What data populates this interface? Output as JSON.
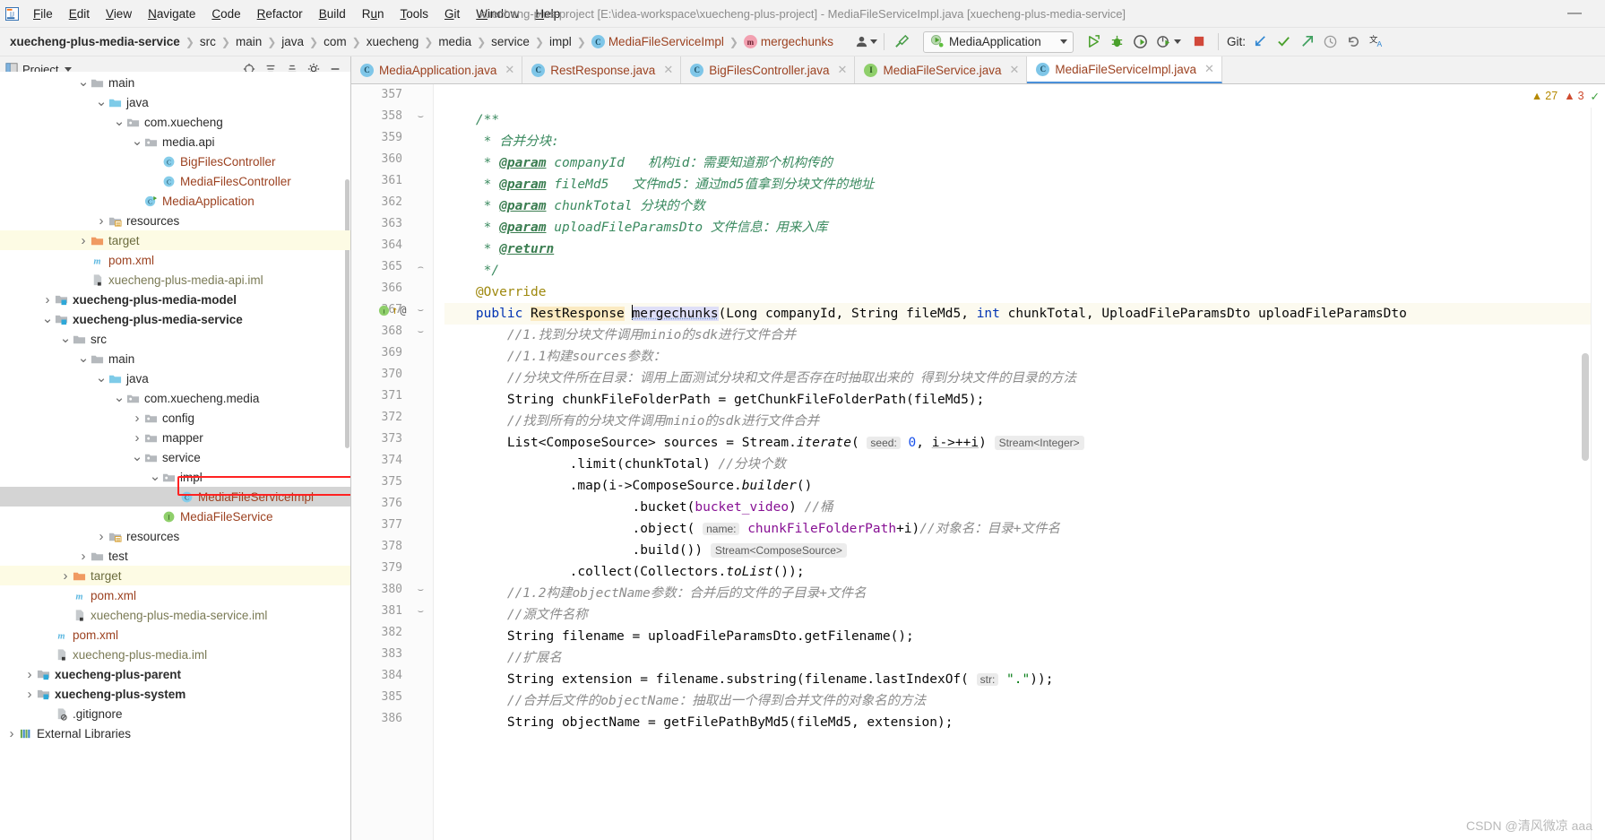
{
  "window": {
    "title": "xuecheng-plus-project [E:\\idea-workspace\\xuecheng-plus-project] - MediaFileServiceImpl.java [xuecheng-plus-media-service]",
    "minimize": "—"
  },
  "menubar": [
    {
      "label": "File"
    },
    {
      "label": "Edit"
    },
    {
      "label": "View"
    },
    {
      "label": "Navigate"
    },
    {
      "label": "Code"
    },
    {
      "label": "Refactor"
    },
    {
      "label": "Build"
    },
    {
      "label": "Run"
    },
    {
      "label": "Tools"
    },
    {
      "label": "Git"
    },
    {
      "label": "Window"
    },
    {
      "label": "Help"
    }
  ],
  "navbar": {
    "crumbs": [
      {
        "label": "xuecheng-plus-media-service",
        "bold": true
      },
      {
        "label": "src"
      },
      {
        "label": "main"
      },
      {
        "label": "java"
      },
      {
        "label": "com"
      },
      {
        "label": "xuecheng"
      },
      {
        "label": "media"
      },
      {
        "label": "service"
      },
      {
        "label": "impl"
      },
      {
        "label": "MediaFileServiceImpl",
        "badge": "c"
      },
      {
        "label": "mergechunks",
        "badge": "m"
      }
    ],
    "run_config": "MediaApplication",
    "git_label": "Git:",
    "separator": "›"
  },
  "project_panel": {
    "title": "Project",
    "tree": [
      {
        "indent": 4,
        "arrow": "v",
        "icon": "folder-gray",
        "label": "main",
        "style": "plain",
        "partial": true
      },
      {
        "indent": 5,
        "arrow": "v",
        "icon": "folder-blue",
        "label": "java",
        "style": "plain"
      },
      {
        "indent": 6,
        "arrow": "v",
        "icon": "package",
        "label": "com.xuecheng",
        "style": "plain"
      },
      {
        "indent": 7,
        "arrow": "v",
        "icon": "package",
        "label": "media.api",
        "style": "plain"
      },
      {
        "indent": 8,
        "arrow": "",
        "icon": "class",
        "label": "BigFilesController",
        "style": "cls"
      },
      {
        "indent": 8,
        "arrow": "",
        "icon": "class",
        "label": "MediaFilesController",
        "style": "cls"
      },
      {
        "indent": 7,
        "arrow": "",
        "icon": "class-run",
        "label": "MediaApplication",
        "style": "cls"
      },
      {
        "indent": 5,
        "arrow": ">",
        "icon": "folder-res",
        "label": "resources",
        "style": "plain"
      },
      {
        "indent": 4,
        "arrow": ">",
        "icon": "folder-orange",
        "label": "target",
        "style": "target",
        "highlight": true
      },
      {
        "indent": 4,
        "arrow": "",
        "icon": "maven",
        "label": "pom.xml",
        "style": "pom"
      },
      {
        "indent": 4,
        "arrow": "",
        "icon": "iml",
        "label": "xuecheng-plus-media-api.iml",
        "style": "file"
      },
      {
        "indent": 2,
        "arrow": ">",
        "icon": "module",
        "label": "xuecheng-plus-media-model",
        "style": "bold"
      },
      {
        "indent": 2,
        "arrow": "v",
        "icon": "module",
        "label": "xuecheng-plus-media-service",
        "style": "bold"
      },
      {
        "indent": 3,
        "arrow": "v",
        "icon": "folder-gray",
        "label": "src",
        "style": "plain"
      },
      {
        "indent": 4,
        "arrow": "v",
        "icon": "folder-gray",
        "label": "main",
        "style": "plain"
      },
      {
        "indent": 5,
        "arrow": "v",
        "icon": "folder-blue",
        "label": "java",
        "style": "plain"
      },
      {
        "indent": 6,
        "arrow": "v",
        "icon": "package",
        "label": "com.xuecheng.media",
        "style": "plain"
      },
      {
        "indent": 7,
        "arrow": ">",
        "icon": "package",
        "label": "config",
        "style": "plain"
      },
      {
        "indent": 7,
        "arrow": ">",
        "icon": "package",
        "label": "mapper",
        "style": "plain"
      },
      {
        "indent": 7,
        "arrow": "v",
        "icon": "package",
        "label": "service",
        "style": "plain"
      },
      {
        "indent": 8,
        "arrow": "v",
        "icon": "package",
        "label": "impl",
        "style": "plain"
      },
      {
        "indent": 9,
        "arrow": "",
        "icon": "class",
        "label": "MediaFileServiceImpl",
        "style": "cls",
        "selected": true,
        "outlined": true
      },
      {
        "indent": 8,
        "arrow": "",
        "icon": "interface",
        "label": "MediaFileService",
        "style": "cls"
      },
      {
        "indent": 5,
        "arrow": ">",
        "icon": "folder-res",
        "label": "resources",
        "style": "plain"
      },
      {
        "indent": 4,
        "arrow": ">",
        "icon": "folder-gray",
        "label": "test",
        "style": "plain"
      },
      {
        "indent": 3,
        "arrow": ">",
        "icon": "folder-orange",
        "label": "target",
        "style": "target",
        "highlight": true
      },
      {
        "indent": 3,
        "arrow": "",
        "icon": "maven",
        "label": "pom.xml",
        "style": "pom"
      },
      {
        "indent": 3,
        "arrow": "",
        "icon": "iml",
        "label": "xuecheng-plus-media-service.iml",
        "style": "file"
      },
      {
        "indent": 2,
        "arrow": "",
        "icon": "maven",
        "label": "pom.xml",
        "style": "pom"
      },
      {
        "indent": 2,
        "arrow": "",
        "icon": "iml",
        "label": "xuecheng-plus-media.iml",
        "style": "file"
      },
      {
        "indent": 1,
        "arrow": ">",
        "icon": "module",
        "label": "xuecheng-plus-parent",
        "style": "bold"
      },
      {
        "indent": 1,
        "arrow": ">",
        "icon": "module",
        "label": "xuecheng-plus-system",
        "style": "bold"
      },
      {
        "indent": 2,
        "arrow": "",
        "icon": "gitignore",
        "label": ".gitignore",
        "style": "plain"
      },
      {
        "indent": 0,
        "arrow": ">",
        "icon": "libs",
        "label": "External Libraries",
        "style": "plain"
      }
    ]
  },
  "editor_tabs": [
    {
      "label": "MediaApplication.java",
      "badge": "run",
      "active": false
    },
    {
      "label": "RestResponse.java",
      "badge": "c",
      "active": false
    },
    {
      "label": "BigFilesController.java",
      "badge": "c",
      "active": false
    },
    {
      "label": "MediaFileService.java",
      "badge": "i",
      "active": false
    },
    {
      "label": "MediaFileServiceImpl.java",
      "badge": "c",
      "active": true
    }
  ],
  "status": {
    "warnings": "27",
    "errors": "3",
    "warn_icon": "warning-triangle-icon",
    "err_icon": "error-triangle-icon",
    "ok_icon": "checkmark-icon"
  },
  "code": {
    "first_line": 357,
    "current_line": 367,
    "lines": [
      {
        "n": 357,
        "segs": []
      },
      {
        "n": 358,
        "fold": "v",
        "segs": [
          {
            "t": "    ",
            "c": ""
          },
          {
            "t": "/**",
            "c": "doc"
          }
        ]
      },
      {
        "n": 359,
        "segs": [
          {
            "t": "     * ",
            "c": "doc"
          },
          {
            "t": "合并分块:",
            "c": "doc"
          }
        ]
      },
      {
        "n": 360,
        "segs": [
          {
            "t": "     * ",
            "c": "doc"
          },
          {
            "t": "@param",
            "c": "doctag"
          },
          {
            "t": " companyId",
            "c": "doc"
          },
          {
            "t": "   机构id：需要知道那个机构传的",
            "c": "doc"
          }
        ]
      },
      {
        "n": 361,
        "segs": [
          {
            "t": "     * ",
            "c": "doc"
          },
          {
            "t": "@param",
            "c": "doctag"
          },
          {
            "t": " fileMd5",
            "c": "doc"
          },
          {
            "t": "   文件md5：通过md5值拿到分块文件的地址",
            "c": "doc"
          }
        ]
      },
      {
        "n": 362,
        "segs": [
          {
            "t": "     * ",
            "c": "doc"
          },
          {
            "t": "@param",
            "c": "doctag"
          },
          {
            "t": " chunkTotal",
            "c": "doc"
          },
          {
            "t": " 分块的个数",
            "c": "doc"
          }
        ]
      },
      {
        "n": 363,
        "segs": [
          {
            "t": "     * ",
            "c": "doc"
          },
          {
            "t": "@param",
            "c": "doctag"
          },
          {
            "t": " uploadFileParamsDto",
            "c": "doc"
          },
          {
            "t": " 文件信息：用来入库",
            "c": "doc"
          }
        ]
      },
      {
        "n": 364,
        "segs": [
          {
            "t": "     * ",
            "c": "doc"
          },
          {
            "t": "@return",
            "c": "doctag"
          }
        ]
      },
      {
        "n": 365,
        "fold": "^",
        "segs": [
          {
            "t": "     */",
            "c": "doc"
          }
        ]
      },
      {
        "n": 366,
        "segs": [
          {
            "t": "    ",
            "c": ""
          },
          {
            "t": "@Override",
            "c": "anno"
          }
        ]
      },
      {
        "n": 367,
        "fold": "v",
        "current": true,
        "segs": [
          {
            "t": "    ",
            "c": ""
          },
          {
            "t": "public ",
            "c": "kw"
          },
          {
            "t": "RestResponse",
            "c": "hl-type"
          },
          {
            "t": " ",
            "c": ""
          },
          {
            "t": "mergechunks",
            "c": "hl-ident"
          },
          {
            "t": "(",
            "c": ""
          },
          {
            "t": "Long",
            "c": ""
          },
          {
            "t": " companyId, ",
            "c": ""
          },
          {
            "t": "String",
            "c": ""
          },
          {
            "t": " fileMd5, ",
            "c": ""
          },
          {
            "t": "int",
            "c": "kw"
          },
          {
            "t": " chunkTotal, UploadFileParamsDto uploadFileParamsDto",
            "c": ""
          }
        ]
      },
      {
        "n": 368,
        "fold": "v",
        "segs": [
          {
            "t": "        ",
            "c": ""
          },
          {
            "t": "//1.找到分块文件调用minio的sdk进行文件合并",
            "c": "cmt"
          }
        ]
      },
      {
        "n": 369,
        "segs": [
          {
            "t": "        ",
            "c": ""
          },
          {
            "t": "//1.1构建sources参数：",
            "c": "cmt"
          }
        ]
      },
      {
        "n": 370,
        "segs": [
          {
            "t": "        ",
            "c": ""
          },
          {
            "t": "//分块文件所在目录：调用上面测试分块和文件是否存在时抽取出来的 得到分块文件的目录的方法",
            "c": "cmt"
          }
        ]
      },
      {
        "n": 371,
        "segs": [
          {
            "t": "        String chunkFileFolderPath = getChunkFileFolderPath(fileMd5);",
            "c": ""
          }
        ]
      },
      {
        "n": 372,
        "segs": [
          {
            "t": "        ",
            "c": ""
          },
          {
            "t": "//找到所有的分块文件调用minio的sdk进行文件合并",
            "c": "cmt"
          }
        ]
      },
      {
        "n": 373,
        "segs": [
          {
            "t": "        List<ComposeSource> sources = Stream.",
            "c": ""
          },
          {
            "t": "iterate",
            "c": "ital"
          },
          {
            "t": "( ",
            "c": ""
          },
          {
            "t": "seed:",
            "c": "inlay"
          },
          {
            "t": " ",
            "c": ""
          },
          {
            "t": "0",
            "c": "num"
          },
          {
            "t": ", ",
            "c": ""
          },
          {
            "t": "i->++i",
            "c": "undl"
          },
          {
            "t": ") ",
            "c": ""
          },
          {
            "t": "Stream<Integer>",
            "c": "hint"
          }
        ]
      },
      {
        "n": 374,
        "segs": [
          {
            "t": "                .limit(chunkTotal) ",
            "c": ""
          },
          {
            "t": "//分块个数",
            "c": "cmt"
          }
        ]
      },
      {
        "n": 375,
        "segs": [
          {
            "t": "                .map(i->ComposeSource.",
            "c": ""
          },
          {
            "t": "builder",
            "c": "ital"
          },
          {
            "t": "()",
            "c": ""
          }
        ]
      },
      {
        "n": 376,
        "segs": [
          {
            "t": "                        .bucket(",
            "c": ""
          },
          {
            "t": "bucket_video",
            "c": "fld"
          },
          {
            "t": ") ",
            "c": ""
          },
          {
            "t": "//桶",
            "c": "cmt"
          }
        ]
      },
      {
        "n": 377,
        "segs": [
          {
            "t": "                        .object( ",
            "c": ""
          },
          {
            "t": "name:",
            "c": "inlay"
          },
          {
            "t": " ",
            "c": ""
          },
          {
            "t": "chunkFileFolderPath",
            "c": "fld"
          },
          {
            "t": "+i)",
            "c": ""
          },
          {
            "t": "//对象名：目录+文件名",
            "c": "cmt"
          }
        ]
      },
      {
        "n": 378,
        "segs": [
          {
            "t": "                        .build()) ",
            "c": ""
          },
          {
            "t": "Stream<ComposeSource>",
            "c": "hint"
          }
        ]
      },
      {
        "n": 379,
        "segs": [
          {
            "t": "                .collect(Collectors.",
            "c": ""
          },
          {
            "t": "toList",
            "c": "ital"
          },
          {
            "t": "());",
            "c": ""
          }
        ]
      },
      {
        "n": 380,
        "fold": "v",
        "segs": [
          {
            "t": "        ",
            "c": ""
          },
          {
            "t": "//1.2构建objectName参数：合并后的文件的子目录+文件名",
            "c": "cmt"
          }
        ]
      },
      {
        "n": 381,
        "fold": "v",
        "segs": [
          {
            "t": "        ",
            "c": ""
          },
          {
            "t": "//源文件名称",
            "c": "cmt"
          }
        ]
      },
      {
        "n": 382,
        "segs": [
          {
            "t": "        String filename = uploadFileParamsDto.getFilename();",
            "c": ""
          }
        ]
      },
      {
        "n": 383,
        "segs": [
          {
            "t": "        ",
            "c": ""
          },
          {
            "t": "//扩展名",
            "c": "cmt"
          }
        ]
      },
      {
        "n": 384,
        "segs": [
          {
            "t": "        String extension = filename.substring(filename.lastIndexOf( ",
            "c": ""
          },
          {
            "t": "str:",
            "c": "inlay"
          },
          {
            "t": " ",
            "c": ""
          },
          {
            "t": "\".\"",
            "c": "str"
          },
          {
            "t": "));",
            "c": ""
          }
        ]
      },
      {
        "n": 385,
        "segs": [
          {
            "t": "        ",
            "c": ""
          },
          {
            "t": "//合并后文件的objectName：抽取出一个得到合并文件的对象名的方法",
            "c": "cmt"
          }
        ]
      },
      {
        "n": 386,
        "segs": [
          {
            "t": "        String objectName = getFilePathByMd5(fileMd5, extension);",
            "c": ""
          }
        ]
      }
    ]
  },
  "watermark": "CSDN @清风微凉 aaa"
}
